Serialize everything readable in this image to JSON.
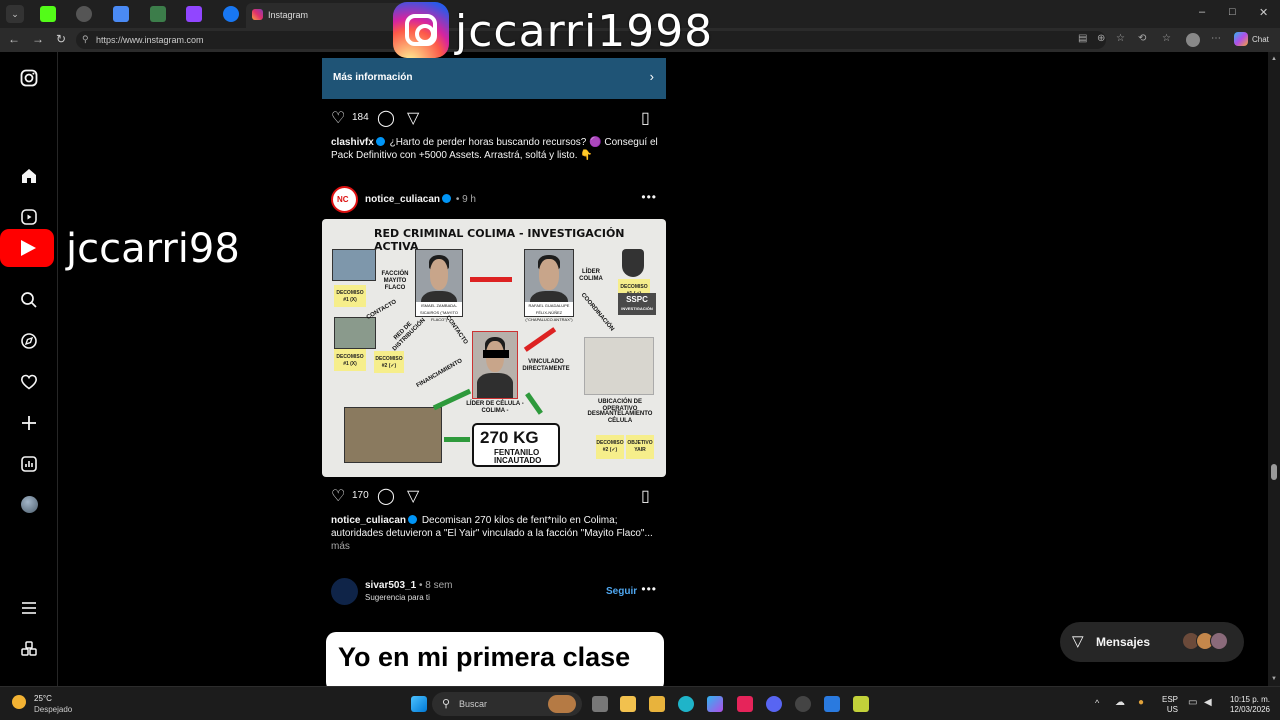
{
  "browser": {
    "active_tab_title": "Instagram",
    "url": "https://www.instagram.com",
    "chat_label": "Chat",
    "window_controls": [
      "–",
      "□",
      "✕"
    ]
  },
  "overlay": {
    "instagram_handle": "jccarri1998",
    "youtube_handle": "jccarri98"
  },
  "ad": {
    "cta_label": "Más información",
    "likes": "184",
    "author": "clashivfx",
    "caption": "¿Harto de perder horas buscando recursos? 🟣 Conseguí el Pack Definitivo con +5000 Assets. Arrastrá, soltá y listo. 👇"
  },
  "post1": {
    "author": "notice_culiacan",
    "time": "• 9 h",
    "avatar_text": "NC",
    "likes": "170",
    "caption_author": "notice_culiacan",
    "caption": "Decomisan 270 kilos de fent*nilo en Colima; autoridades detuvieron a \"El Yair\" vinculado a la facción \"Mayito Flaco\"...",
    "more": "más",
    "image": {
      "title": "RED CRIMINAL COLIMA - INVESTIGACIÓN ACTIVA",
      "faccion_label": "FACCIÓN MAYITO FLACO",
      "person1_caption": "ISMAEL ZAMBADA-SICAIROS (\"MAYITO FLACO\")",
      "person2_caption": "RAFAEL GUADALUPE FÉLIX-NÚÑEZ (\"CHAPALUCO ANTRAX\")",
      "lider_label": "LÍDER COLIMA",
      "sspc": "SSPC",
      "sspc_sub": "INVESTIGACIÓN",
      "center_caption": "LÍDER DE CÉLULA - COLIMA -",
      "vinculado": "VINCULADO DIRECTAMENTE",
      "ubicacion": "UBICACIÓN DE OPERATIVO",
      "desmantelamiento": "DESMANTELAMIENTO CÉLULA",
      "decomiso1x_a": "DECOMISO #1 (X)",
      "decomiso1x_b": "DECOMISO #1 (X)",
      "decomiso2_a": "DECOMISO #2 (✓)",
      "decomiso1_r": "DECOMISO #1 (✓)",
      "decomiso2_r": "DECOMISO #2 (✓)",
      "objetivo": "OBJETIVO YAIR",
      "contacto": "CONTACTO",
      "red_distribucion": "RED DE DISTRIBUCIÓN",
      "contacto2": "CONTACTO",
      "coordinacion": "COORDINACIÓN",
      "financiamiento": "FINANCIAMIENTO",
      "kg": "270 KG",
      "kg_sub": "FENTANILO INCAUTADO"
    }
  },
  "post2": {
    "author": "sivar503_1",
    "time": "• 8 sem",
    "subtitle": "Sugerencia para ti",
    "follow": "Seguir",
    "image_text": "Yo en mi primera clase"
  },
  "messages": {
    "label": "Mensajes"
  },
  "taskbar": {
    "weather_temp": "25°C",
    "weather_desc": "Despejado",
    "search_placeholder": "Buscar",
    "lang": "ESP",
    "lang_sub": "US",
    "time": "10:15 p. m.",
    "date": "12/03/2026"
  },
  "colors": {
    "ad_banner": "#1f5476",
    "link_blue": "#4fa7f0",
    "verified": "#0095f6"
  }
}
